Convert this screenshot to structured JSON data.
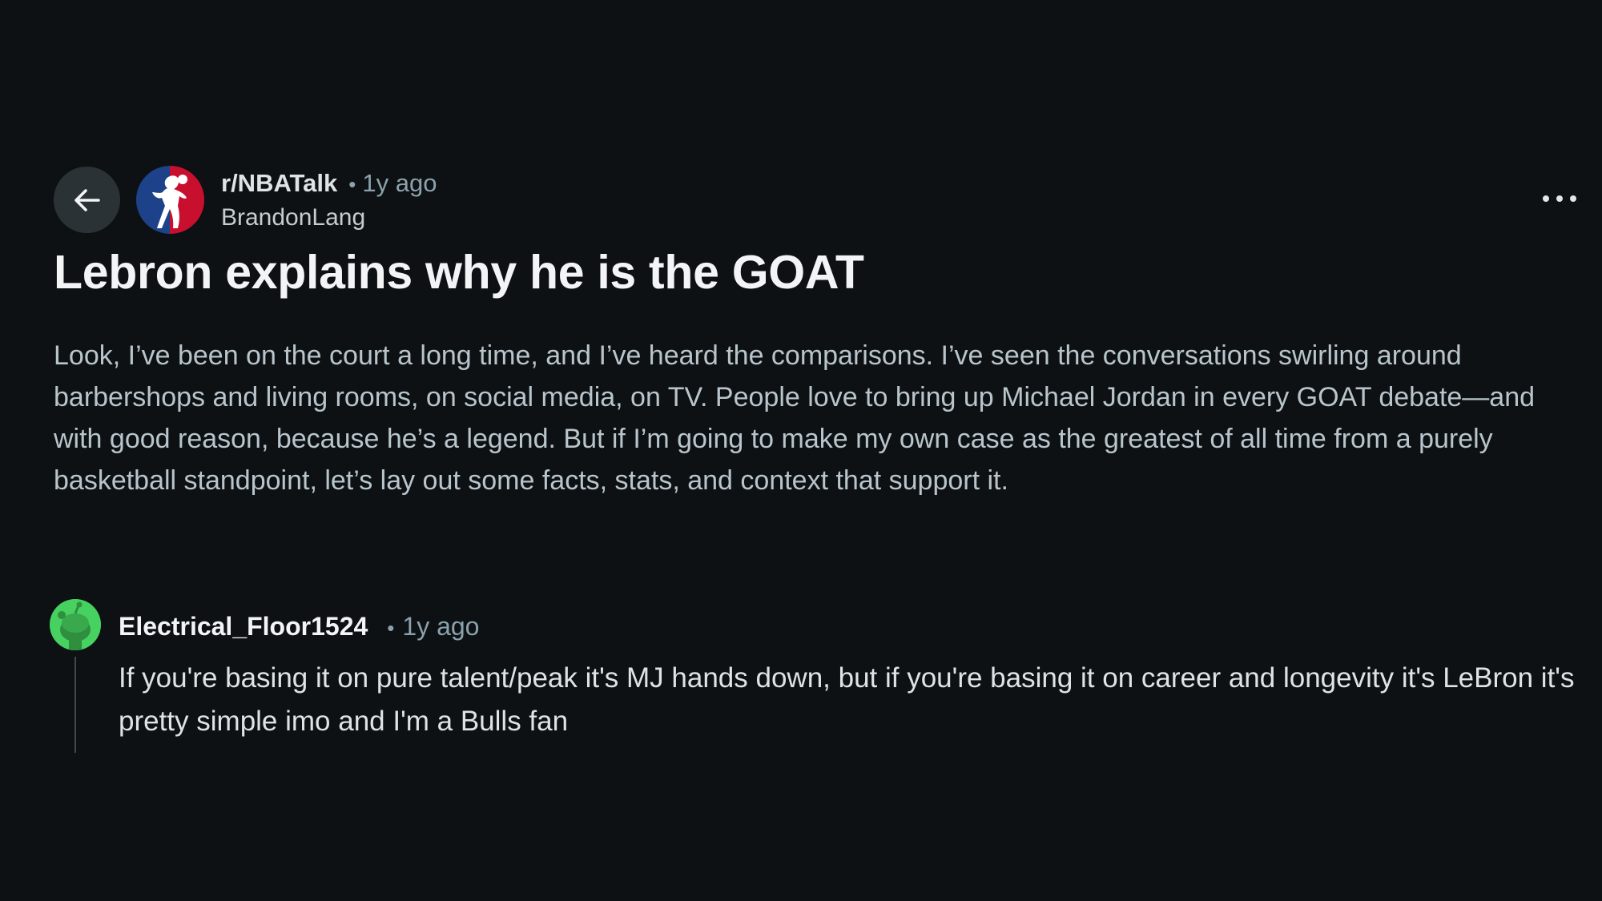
{
  "post": {
    "subreddit": "r/NBATalk",
    "separator": "•",
    "age": "1y ago",
    "author": "BrandonLang",
    "title": "Lebron explains why he is the GOAT",
    "body": "Look, I’ve been on the court a long time, and I’ve heard the comparisons. I’ve seen the conversations swirling around barbershops and living rooms, on social media, on TV. People love to bring up Michael Jordan in every GOAT debate—and with good reason, because he’s a legend. But if I’m going to make my own case as the greatest of all time from a purely basketball standpoint, let’s lay out some facts, stats, and context that support it."
  },
  "comment": {
    "author": "Electrical_Floor1524",
    "separator": "•",
    "age": "1y ago",
    "text": "If you're basing it on pure talent/peak it's MJ hands down, but if you're basing it on career and longevity it's LeBron it's pretty simple imo and I'm a Bulls fan"
  },
  "icons": {
    "back": "arrow-left-icon",
    "more": "more-horizontal-icon",
    "subreddit_avatar": "nba-logo-icon",
    "comment_avatar": "snoo-avatar-icon"
  },
  "colors": {
    "background": "#0e1113",
    "comment_avatar": "#46d160",
    "nba_blue": "#1d428a",
    "nba_red": "#c8102e"
  }
}
